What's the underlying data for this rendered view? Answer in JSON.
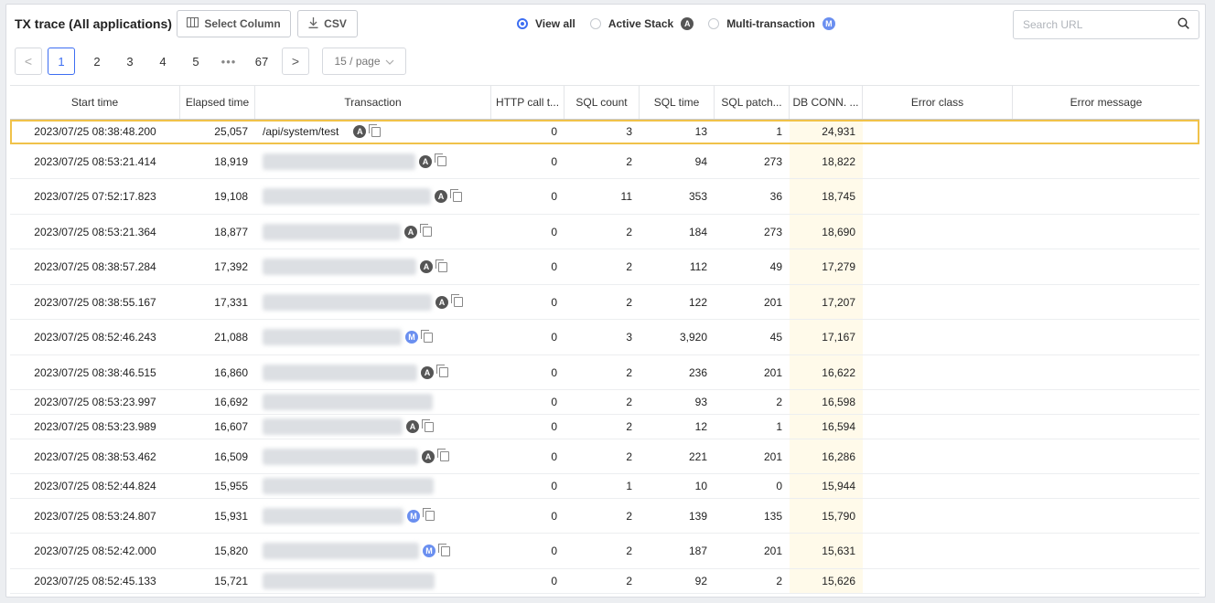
{
  "toolbar": {
    "title": "TX trace (All applications)",
    "select_column_label": "Select Column",
    "csv_label": "CSV",
    "view_all_label": "View all",
    "active_stack_label": "Active Stack",
    "active_stack_badge": "A",
    "multi_tx_label": "Multi-transaction",
    "multi_tx_badge": "M",
    "search_placeholder": "Search URL"
  },
  "pagination": {
    "prev": "<",
    "pages": [
      "1",
      "2",
      "3",
      "4",
      "5"
    ],
    "ellipsis": "•••",
    "last": "67",
    "next": ">",
    "page_size": "15 / page"
  },
  "columns": [
    "Start time",
    "Elapsed time",
    "Transaction",
    "HTTP call t...",
    "SQL count",
    "SQL time",
    "SQL patch...",
    "DB CONN. ...",
    "Error class",
    "Error message"
  ],
  "rows": [
    {
      "start": "2023/07/25 08:38:48.200",
      "elapsed": "25,057",
      "tx": "/api/system/test",
      "badge": "A",
      "http": "0",
      "sql_count": "3",
      "sql_time": "13",
      "sql_patch": "1",
      "db_conn": "24,931"
    },
    {
      "start": "2023/07/25 08:53:21.414",
      "elapsed": "18,919",
      "tx": "",
      "badge": "A",
      "http": "0",
      "sql_count": "2",
      "sql_time": "94",
      "sql_patch": "273",
      "db_conn": "18,822"
    },
    {
      "start": "2023/07/25 07:52:17.823",
      "elapsed": "19,108",
      "tx": "",
      "badge": "A",
      "http": "0",
      "sql_count": "11",
      "sql_time": "353",
      "sql_patch": "36",
      "db_conn": "18,745"
    },
    {
      "start": "2023/07/25 08:53:21.364",
      "elapsed": "18,877",
      "tx": "",
      "badge": "A",
      "http": "0",
      "sql_count": "2",
      "sql_time": "184",
      "sql_patch": "273",
      "db_conn": "18,690"
    },
    {
      "start": "2023/07/25 08:38:57.284",
      "elapsed": "17,392",
      "tx": "",
      "badge": "A",
      "http": "0",
      "sql_count": "2",
      "sql_time": "112",
      "sql_patch": "49",
      "db_conn": "17,279"
    },
    {
      "start": "2023/07/25 08:38:55.167",
      "elapsed": "17,331",
      "tx": "",
      "badge": "A",
      "http": "0",
      "sql_count": "2",
      "sql_time": "122",
      "sql_patch": "201",
      "db_conn": "17,207"
    },
    {
      "start": "2023/07/25 08:52:46.243",
      "elapsed": "21,088",
      "tx": "",
      "badge": "M",
      "http": "0",
      "sql_count": "3",
      "sql_time": "3,920",
      "sql_patch": "45",
      "db_conn": "17,167"
    },
    {
      "start": "2023/07/25 08:38:46.515",
      "elapsed": "16,860",
      "tx": "",
      "badge": "A",
      "http": "0",
      "sql_count": "2",
      "sql_time": "236",
      "sql_patch": "201",
      "db_conn": "16,622"
    },
    {
      "start": "2023/07/25 08:53:23.997",
      "elapsed": "16,692",
      "tx": "",
      "badge": "",
      "http": "0",
      "sql_count": "2",
      "sql_time": "93",
      "sql_patch": "2",
      "db_conn": "16,598"
    },
    {
      "start": "2023/07/25 08:53:23.989",
      "elapsed": "16,607",
      "tx": "",
      "badge": "A",
      "http": "0",
      "sql_count": "2",
      "sql_time": "12",
      "sql_patch": "1",
      "db_conn": "16,594"
    },
    {
      "start": "2023/07/25 08:38:53.462",
      "elapsed": "16,509",
      "tx": "",
      "badge": "A",
      "http": "0",
      "sql_count": "2",
      "sql_time": "221",
      "sql_patch": "201",
      "db_conn": "16,286"
    },
    {
      "start": "2023/07/25 08:52:44.824",
      "elapsed": "15,955",
      "tx": "",
      "badge": "",
      "http": "0",
      "sql_count": "1",
      "sql_time": "10",
      "sql_patch": "0",
      "db_conn": "15,944"
    },
    {
      "start": "2023/07/25 08:53:24.807",
      "elapsed": "15,931",
      "tx": "",
      "badge": "M",
      "http": "0",
      "sql_count": "2",
      "sql_time": "139",
      "sql_patch": "135",
      "db_conn": "15,790"
    },
    {
      "start": "2023/07/25 08:52:42.000",
      "elapsed": "15,820",
      "tx": "",
      "badge": "M",
      "http": "0",
      "sql_count": "2",
      "sql_time": "187",
      "sql_patch": "201",
      "db_conn": "15,631"
    },
    {
      "start": "2023/07/25 08:52:45.133",
      "elapsed": "15,721",
      "tx": "",
      "badge": "",
      "http": "0",
      "sql_count": "2",
      "sql_time": "92",
      "sql_patch": "2",
      "db_conn": "15,626"
    }
  ]
}
